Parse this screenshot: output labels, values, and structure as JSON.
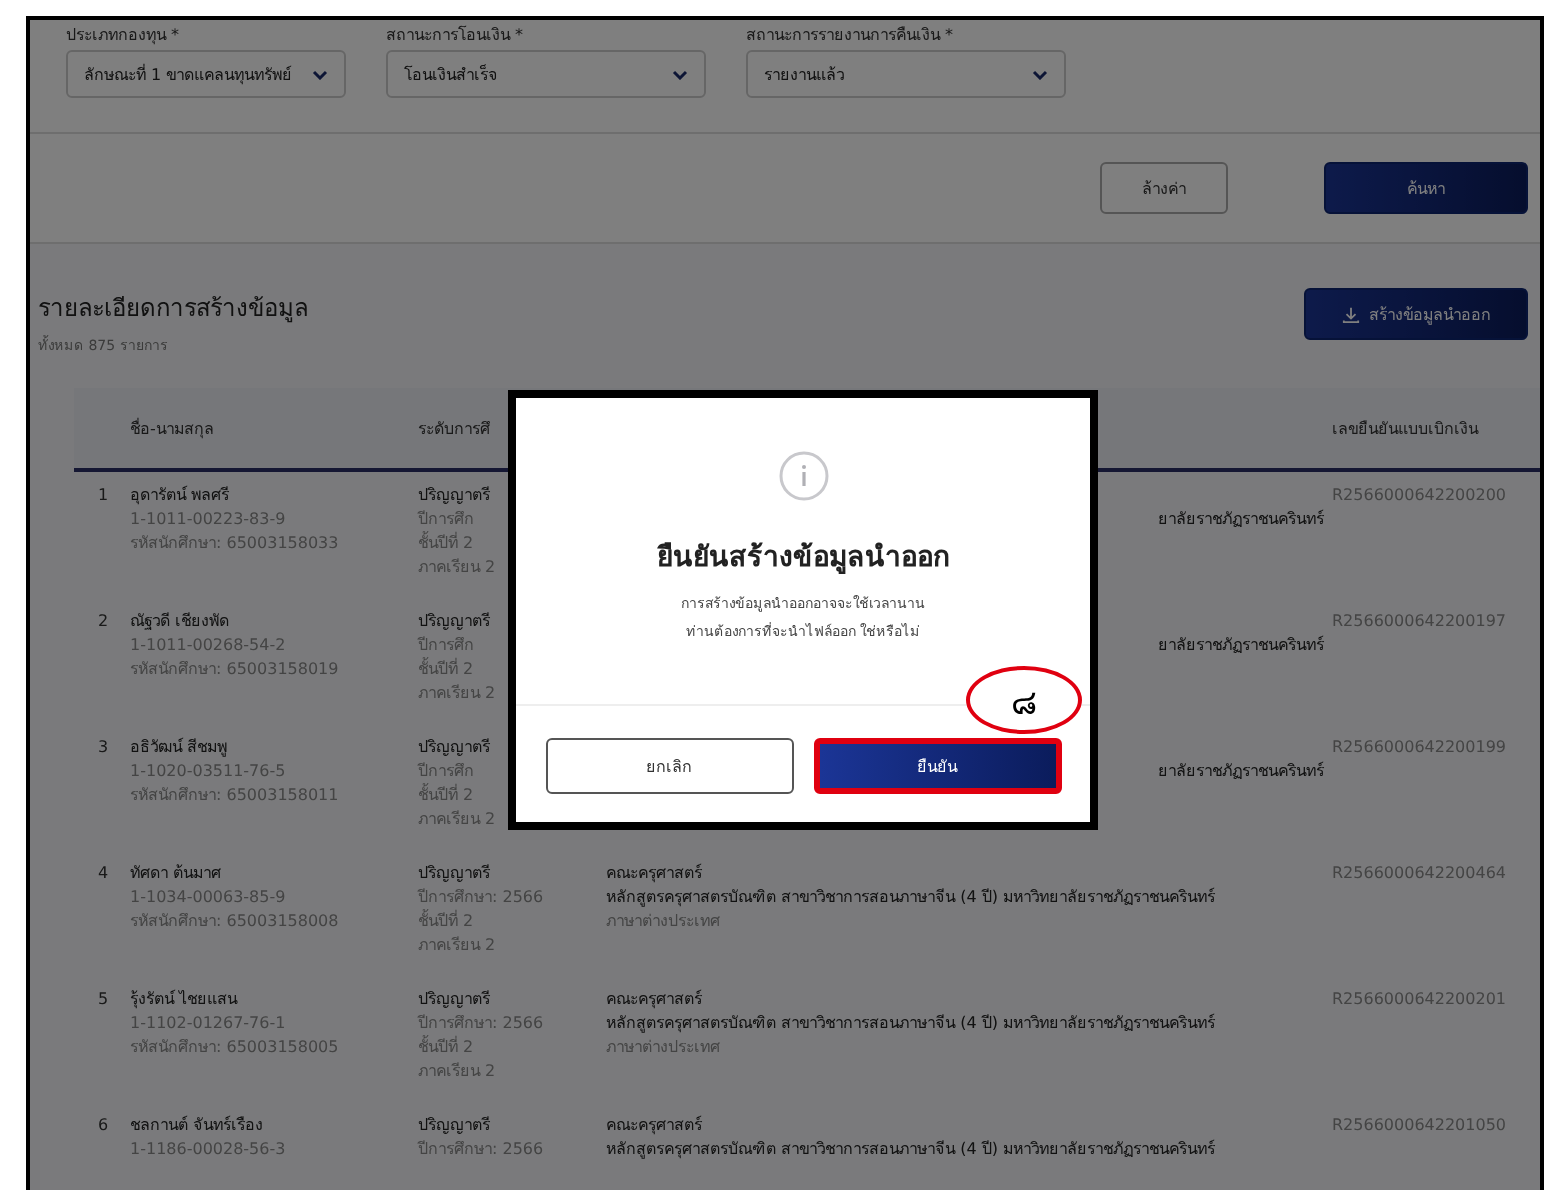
{
  "filters": [
    {
      "label": "ประเภทกองทุน *",
      "value": "ลักษณะที่ 1 ขาดแคลนทุนทรัพย์"
    },
    {
      "label": "สถานะการโอนเงิน *",
      "value": "โอนเงินสำเร็จ"
    },
    {
      "label": "สถานะการรายงานการคืนเงิน *",
      "value": "รายงานแล้ว"
    }
  ],
  "actions": [
    {
      "label": "ล้างค่า",
      "kind": "secondary"
    },
    {
      "label": "ค้นหา",
      "kind": "primary"
    }
  ],
  "section": {
    "title": "รายละเอียดการสร้างข้อมูล",
    "count": "ทั้งหมด 875 รายการ",
    "export_button": "สร้างข้อมูลนำออก"
  },
  "table": {
    "columns": [
      "ชื่อ-นามสกุล",
      "ระดับการศึ",
      "",
      "เลขยืนยันแบบเบิกเงิน"
    ],
    "rows": [
      {
        "no": "1",
        "name": "อุดารัตน์ พลศรี",
        "citizen_id": "1-1011-00223-83-9",
        "student_id": "รหัสนักศึกษา: 65003158033",
        "education": [
          "ปริญญาตรี",
          "ปีการศึก",
          "ชั้นปีที่ 2",
          "ภาคเรียน 2"
        ],
        "program": "ยาลัยราชภัฏราชนครินทร์",
        "covered": true,
        "ref": "R2566000642200200"
      },
      {
        "no": "2",
        "name": "ณัฐวดี เชียงพัด",
        "citizen_id": "1-1011-00268-54-2",
        "student_id": "รหัสนักศึกษา: 65003158019",
        "education": [
          "ปริญญาตรี",
          "ปีการศึก",
          "ชั้นปีที่ 2",
          "ภาคเรียน 2"
        ],
        "program": "ยาลัยราชภัฏราชนครินทร์",
        "covered": true,
        "ref": "R2566000642200197"
      },
      {
        "no": "3",
        "name": "อธิวัฒน์ สีชมพู",
        "citizen_id": "1-1020-03511-76-5",
        "student_id": "รหัสนักศึกษา: 65003158011",
        "education": [
          "ปริญญาตรี",
          "ปีการศึก",
          "ชั้นปีที่ 2",
          "ภาคเรียน 2"
        ],
        "program": "ยาลัยราชภัฏราชนครินทร์",
        "covered": true,
        "ref": "R2566000642200199"
      },
      {
        "no": "4",
        "name": "ทัศดา ต้นมาศ",
        "citizen_id": "1-1034-00063-85-9",
        "student_id": "รหัสนักศึกษา: 65003158008",
        "education": [
          "ปริญญาตรี",
          "ปีการศึกษา: 2566",
          "ชั้นปีที่ 2",
          "ภาคเรียน 2"
        ],
        "faculty": "คณะครุศาสตร์",
        "program": "หลักสูตรครุศาสตรบัณฑิต สาขาวิชาการสอนภาษาจีน (4 ปี) มหาวิทยาลัยราชภัฏราชนครินทร์",
        "major": "ภาษาต่างประเทศ",
        "covered": false,
        "ref": "R2566000642200464"
      },
      {
        "no": "5",
        "name": "รุ้งรัตน์ ไชยแสน",
        "citizen_id": "1-1102-01267-76-1",
        "student_id": "รหัสนักศึกษา: 65003158005",
        "education": [
          "ปริญญาตรี",
          "ปีการศึกษา: 2566",
          "ชั้นปีที่ 2",
          "ภาคเรียน 2"
        ],
        "faculty": "คณะครุศาสตร์",
        "program": "หลักสูตรครุศาสตรบัณฑิต สาขาวิชาการสอนภาษาจีน (4 ปี) มหาวิทยาลัยราชภัฏราชนครินทร์",
        "major": "ภาษาต่างประเทศ",
        "covered": false,
        "ref": "R2566000642200201"
      },
      {
        "no": "6",
        "name": "ชลกานต์ จันทร์เรือง",
        "citizen_id": "1-1186-00028-56-3",
        "education": [
          "ปริญญาตรี",
          "ปีการศึกษา: 2566"
        ],
        "faculty": "คณะครุศาสตร์",
        "program": "หลักสูตรครุศาสตรบัณฑิต สาขาวิชาการสอนภาษาจีน (4 ปี) มหาวิทยาลัยราชภัฏราชนครินทร์",
        "covered": false,
        "ref": "R2566000642201050"
      }
    ]
  },
  "dialog": {
    "title": "ยืนยันสร้างข้อมูลนำออก",
    "message": [
      "การสร้างข้อมูลนำออกอาจจะใช้เวลานาน",
      "ท่านต้องการที่จะนำไฟล์ออก ใช่หรือไม่"
    ],
    "buttons": [
      {
        "label": "ยกเลิก",
        "kind": "secondary",
        "highlighted": false
      },
      {
        "label": "ยืนยัน",
        "kind": "primary",
        "highlighted": true
      }
    ],
    "annotation": "๘"
  }
}
